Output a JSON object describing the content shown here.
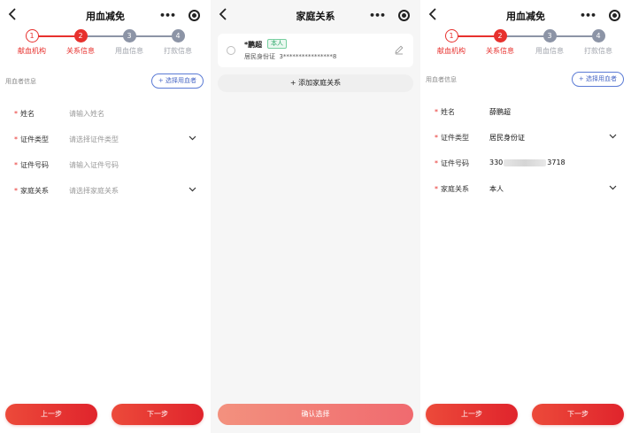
{
  "screens": {
    "left": {
      "title": "用血减免",
      "steps": [
        {
          "num": "1",
          "label": "献血机构",
          "state": "done"
        },
        {
          "num": "2",
          "label": "关系信息",
          "state": "active"
        },
        {
          "num": "3",
          "label": "用血信息",
          "state": "todo"
        },
        {
          "num": "4",
          "label": "打款信息",
          "state": "todo"
        }
      ],
      "section_title": "用血者信息",
      "pick_button": "+ 选择用血者",
      "fields": [
        {
          "label": "姓名",
          "value": "请输入姓名",
          "placeholder": true,
          "dropdown": false
        },
        {
          "label": "证件类型",
          "value": "请选择证件类型",
          "placeholder": true,
          "dropdown": true
        },
        {
          "label": "证件号码",
          "value": "请输入证件号码",
          "placeholder": true,
          "dropdown": false
        },
        {
          "label": "家庭关系",
          "value": "请选择家庭关系",
          "placeholder": true,
          "dropdown": true
        }
      ],
      "prev_label": "上一步",
      "next_label": "下一步"
    },
    "middle": {
      "title": "家庭关系",
      "member": {
        "name": "*鹏超",
        "tag": "本人",
        "id_type": "居民身份证",
        "id_number": "3****************8"
      },
      "add_button": "+ 添加家庭关系",
      "confirm_button": "确认选择"
    },
    "right": {
      "title": "用血减免",
      "steps": [
        {
          "num": "1",
          "label": "献血机构",
          "state": "done"
        },
        {
          "num": "2",
          "label": "关系信息",
          "state": "active"
        },
        {
          "num": "3",
          "label": "用血信息",
          "state": "todo"
        },
        {
          "num": "4",
          "label": "打款信息",
          "state": "todo"
        }
      ],
      "section_title": "用血者信息",
      "pick_button": "+ 选择用血者",
      "fields": [
        {
          "label": "姓名",
          "value": "薛鹏超",
          "dropdown": false
        },
        {
          "label": "证件类型",
          "value": "居民身份证",
          "dropdown": true
        },
        {
          "label": "证件号码",
          "value_prefix": "330",
          "value_suffix": "3718",
          "dropdown": false
        },
        {
          "label": "家庭关系",
          "value": "本人",
          "dropdown": true
        }
      ],
      "prev_label": "上一步",
      "next_label": "下一步"
    }
  },
  "icons": {
    "back": "chevron-left-icon",
    "more": "more-dots-icon",
    "close": "target-circle-icon",
    "edit": "pencil-icon",
    "dropdown": "chevron-down-icon"
  },
  "colors": {
    "accent": "#e7312e",
    "step_todo": "#8c94a6",
    "link_blue": "#4a68c6",
    "tag_green": "#2fa86a",
    "confirm_start": "#f3917e",
    "confirm_end": "#f06a6f"
  }
}
